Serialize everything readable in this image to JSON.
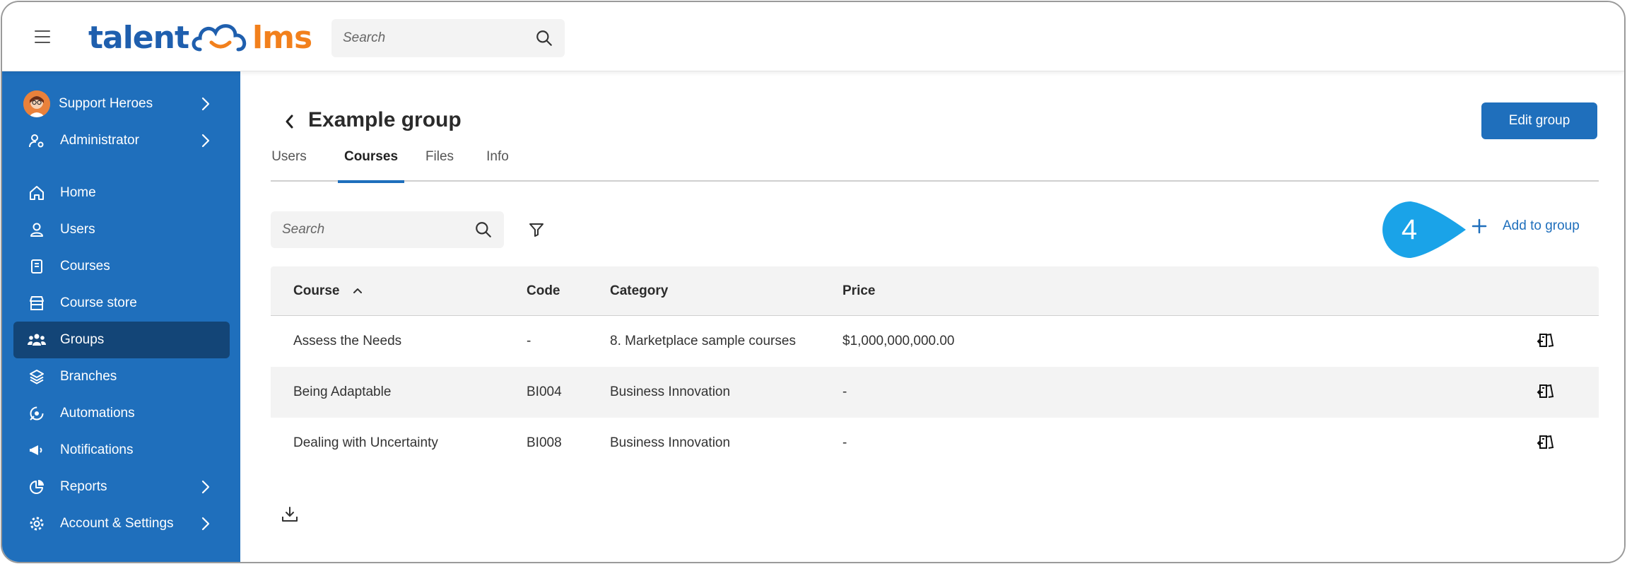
{
  "header": {
    "logo_left": "talent",
    "logo_right": "lms",
    "search_placeholder": "Search"
  },
  "sidebar": {
    "account": {
      "label": "Support Heroes"
    },
    "role": {
      "label": "Administrator"
    },
    "items": [
      {
        "label": "Home",
        "icon": "home-icon"
      },
      {
        "label": "Users",
        "icon": "user-icon"
      },
      {
        "label": "Courses",
        "icon": "book-icon"
      },
      {
        "label": "Course store",
        "icon": "store-icon"
      },
      {
        "label": "Groups",
        "icon": "groups-icon",
        "active": true
      },
      {
        "label": "Branches",
        "icon": "layers-icon"
      },
      {
        "label": "Automations",
        "icon": "automation-icon"
      },
      {
        "label": "Notifications",
        "icon": "megaphone-icon"
      },
      {
        "label": "Reports",
        "icon": "pie-chart-icon"
      },
      {
        "label": "Account & Settings",
        "icon": "gear-icon"
      }
    ]
  },
  "page": {
    "title": "Example group",
    "edit_button": "Edit group",
    "tabs": [
      {
        "label": "Users"
      },
      {
        "label": "Courses",
        "active": true
      },
      {
        "label": "Files"
      },
      {
        "label": "Info"
      }
    ],
    "search_placeholder": "Search",
    "callout_number": "4",
    "add_to_group": "Add to group"
  },
  "table": {
    "columns": [
      "Course",
      "Code",
      "Category",
      "Price"
    ],
    "rows": [
      {
        "course": "Assess the Needs",
        "code": "-",
        "category": "8. Marketplace sample courses",
        "price": "$1,000,000,000.00"
      },
      {
        "course": "Being Adaptable",
        "code": "BI004",
        "category": "Business Innovation",
        "price": "-"
      },
      {
        "course": "Dealing with Uncertainty",
        "code": "BI008",
        "category": "Business Innovation",
        "price": "-"
      }
    ]
  },
  "colors": {
    "brand_blue": "#1f6fbc",
    "sidebar_active": "#134577",
    "logo_orange": "#f2801c",
    "callout_blue": "#1aa3e8"
  }
}
